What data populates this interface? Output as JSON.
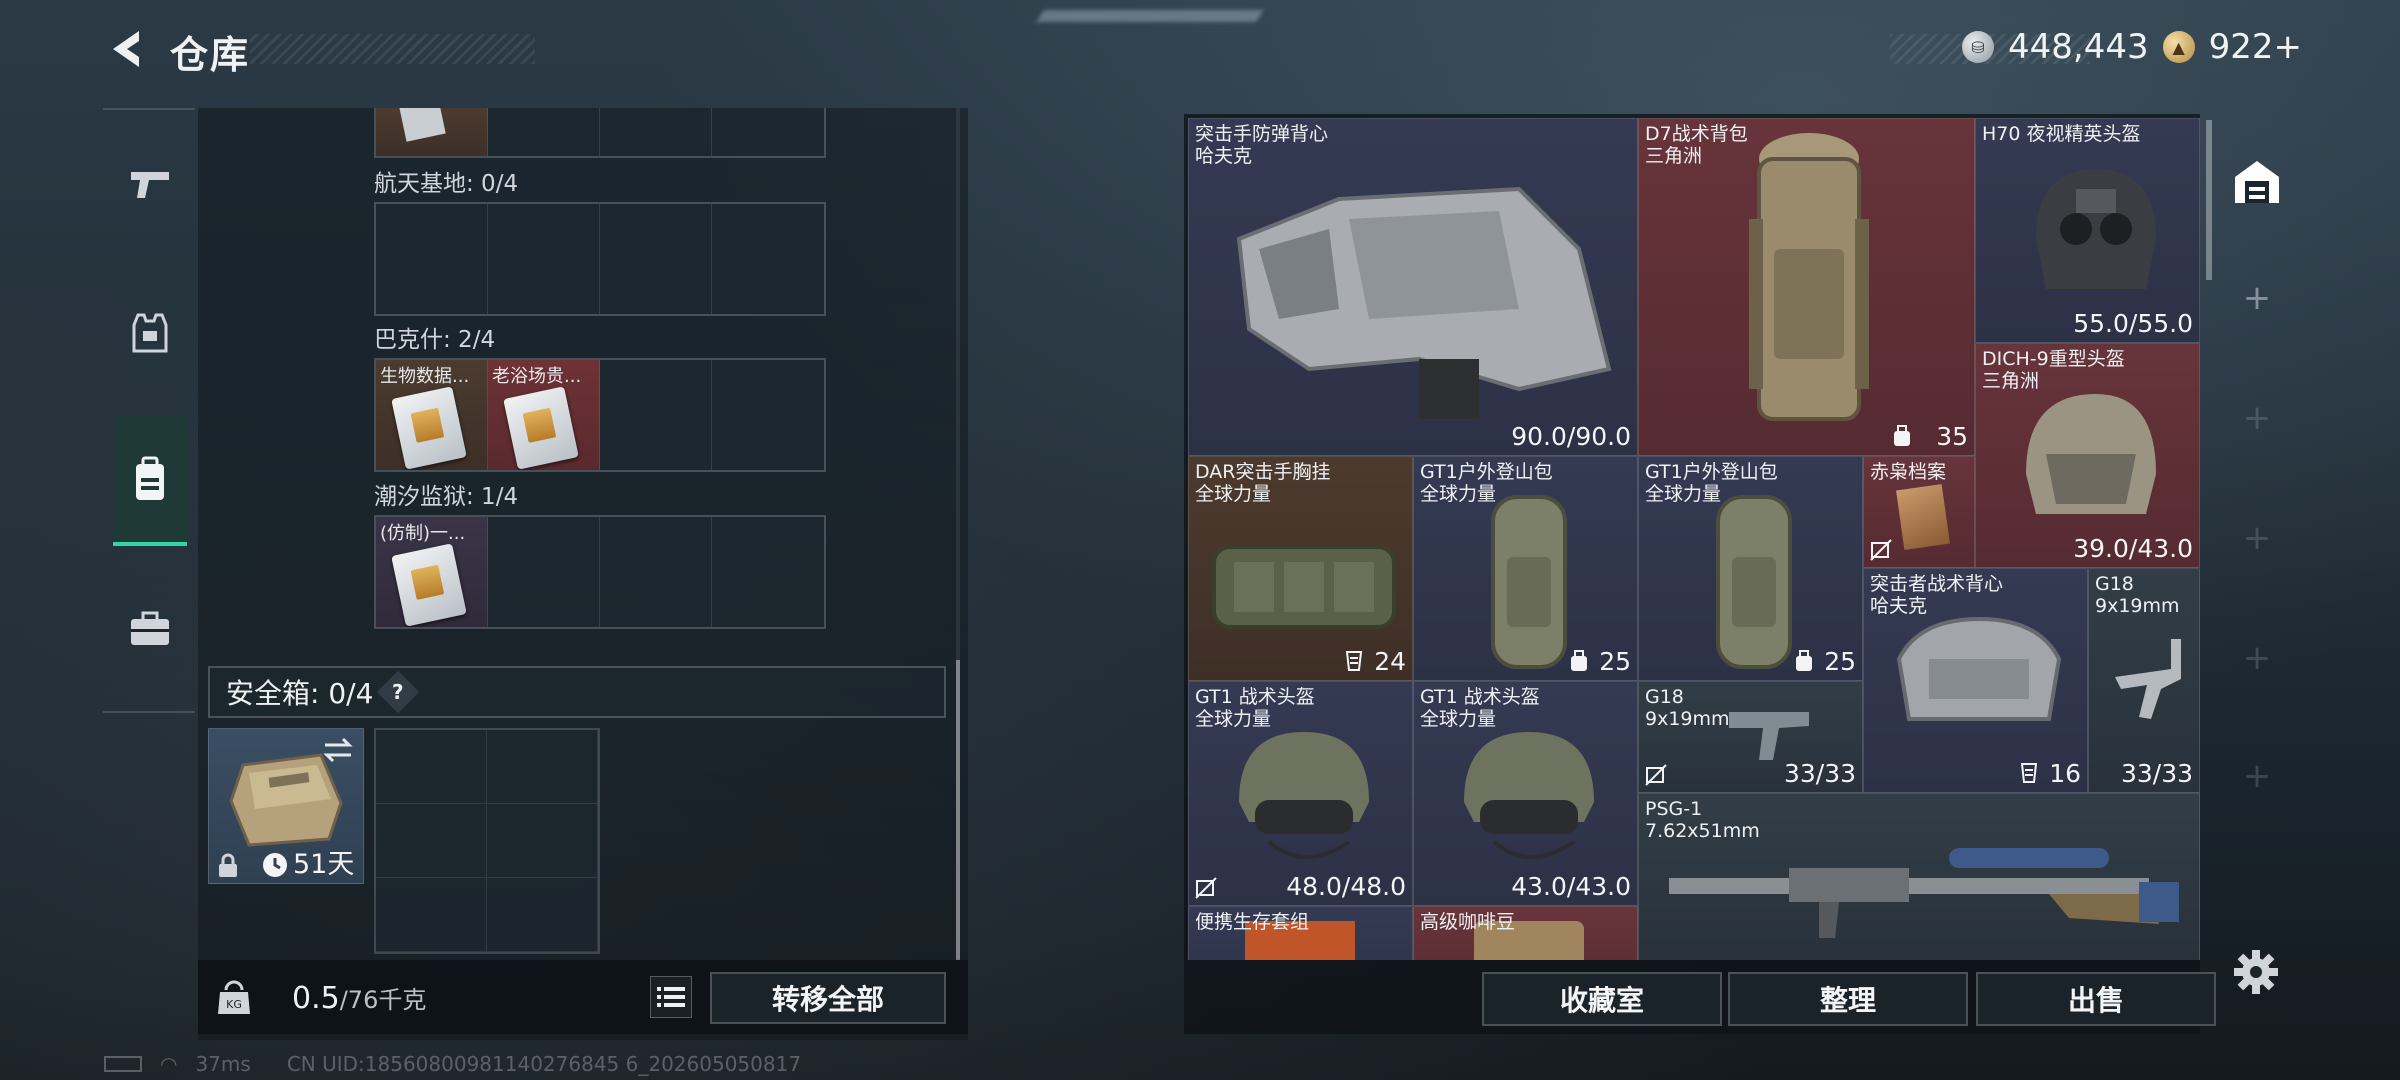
{
  "header": {
    "title": "仓库",
    "currency": [
      {
        "icon": "silver-coin-icon",
        "value": "448,443"
      },
      {
        "icon": "gold-coin-icon",
        "value": "922+"
      }
    ]
  },
  "nav": [
    {
      "name": "weapon-tab",
      "icon": "pistol-icon"
    },
    {
      "name": "armor-tab",
      "icon": "vest-icon"
    },
    {
      "name": "backpack-tab",
      "icon": "backpack-icon",
      "active": true
    },
    {
      "name": "case-tab",
      "icon": "briefcase-icon"
    }
  ],
  "collection": {
    "maps": [
      {
        "label": "航天基地: 0/4",
        "slots": [
          "",
          "",
          "",
          ""
        ]
      },
      {
        "label": "巴克什: 2/4",
        "slots": [
          "生物数据...",
          "老浴场贵...",
          "",
          ""
        ]
      },
      {
        "label": "潮汐监狱: 1/4",
        "slots": [
          "(仿制)一...",
          "",
          "",
          ""
        ]
      }
    ]
  },
  "safe_box": {
    "label": "安全箱:  0/4",
    "help": "?",
    "duration": "51天"
  },
  "footer_left": {
    "weight": "0.5",
    "weight_max": "/76千克",
    "transfer_all": "转移全部"
  },
  "status_bar": {
    "ping": "37ms",
    "uid": "CN UID:18560800981140276845 6_202605050817"
  },
  "warehouse_items": [
    {
      "id": "vest1",
      "name": "突击手防弹背心\n哈夫克",
      "value": "90.0/90.0",
      "bg": "purple"
    },
    {
      "id": "bag1",
      "name": "D7战术背包\n三角洲",
      "value": "35",
      "bg": "red"
    },
    {
      "id": "helmet1",
      "name": "H70 夜视精英头盔",
      "value": "55.0/55.0",
      "bg": "purple"
    },
    {
      "id": "helmet2",
      "name": "DICH-9重型头盔\n三角洲",
      "value": "39.0/43.0",
      "bg": "red"
    },
    {
      "id": "rig1",
      "name": "DAR突击手胸挂\n全球力量",
      "value": "24",
      "bg": "brown"
    },
    {
      "id": "bag2",
      "name": "GT1户外登山包\n全球力量",
      "value": "25",
      "bg": "purple"
    },
    {
      "id": "bag3",
      "name": "GT1户外登山包\n全球力量",
      "value": "25",
      "bg": "purple"
    },
    {
      "id": "doc1",
      "name": "赤枭档案",
      "value": "",
      "bg": "red"
    },
    {
      "id": "vest2",
      "name": "突击者战术背心\n哈夫克",
      "value": "16",
      "bg": "purple"
    },
    {
      "id": "pistol1",
      "name": "G18\n9x19mm",
      "value": "33/33",
      "bg": "gray"
    },
    {
      "id": "helmet3",
      "name": "GT1 战术头盔\n全球力量",
      "value": "48.0/48.0",
      "bg": "purple"
    },
    {
      "id": "helmet4",
      "name": "GT1 战术头盔\n全球力量",
      "value": "43.0/43.0",
      "bg": "purple"
    },
    {
      "id": "pistol2",
      "name": "G18\n9x19mm",
      "value": "33/33",
      "bg": "gray"
    },
    {
      "id": "rifle1",
      "name": "PSG-1\n7.62x51mm",
      "value": "",
      "bg": "gray"
    },
    {
      "id": "kit1",
      "name": "便携生存套组",
      "value": "",
      "bg": "purple"
    },
    {
      "id": "coffee1",
      "name": "高级咖啡豆",
      "value": "",
      "bg": "red"
    }
  ],
  "actions": {
    "collect": "收藏室",
    "sort": "整理",
    "sell": "出售"
  },
  "side_tabs": [
    {
      "icon": "warehouse-icon",
      "active": true
    },
    {
      "icon": "plus-icon"
    },
    {
      "icon": "plus-icon"
    },
    {
      "icon": "plus-icon"
    },
    {
      "icon": "plus-icon"
    },
    {
      "icon": "plus-icon"
    }
  ],
  "colors": {
    "accent": "#2fd7a8",
    "rarity_purple": "#343a52",
    "rarity_red": "#67343a",
    "rarity_brown": "#4d3a2e"
  }
}
